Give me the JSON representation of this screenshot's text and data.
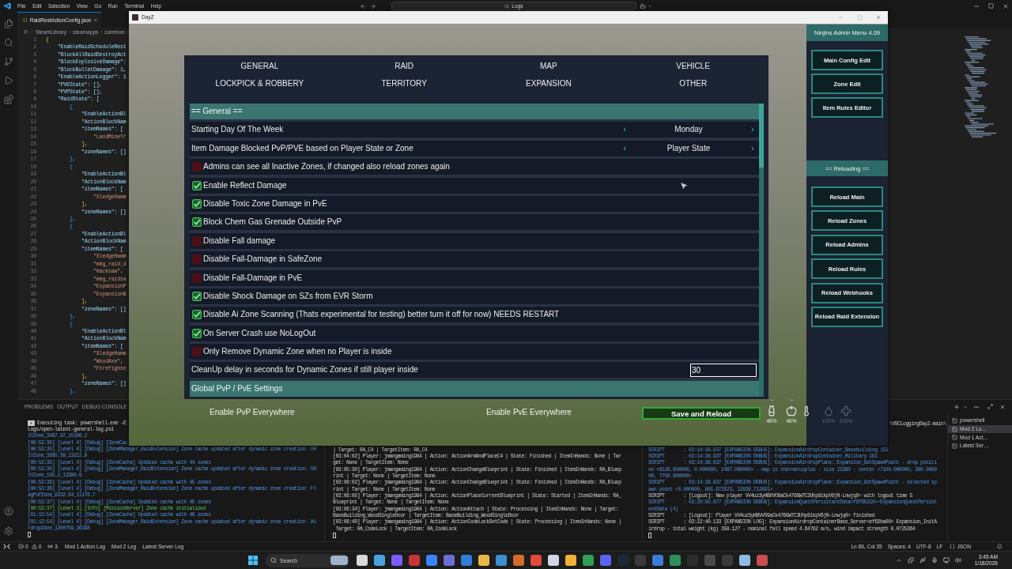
{
  "vscode": {
    "menu": [
      "File",
      "Edit",
      "Selection",
      "View",
      "Go",
      "Run",
      "Terminal",
      "Help"
    ],
    "search": {
      "value": "Logs"
    },
    "tab": {
      "label": "RaidRestrictionConfig.json"
    },
    "breadcrumb": [
      "F:",
      "SteamLibrary",
      "steamapps",
      "common"
    ],
    "code_lines": [
      {
        "number": "1",
        "text": "{",
        "kind": "bracket"
      },
      {
        "number": "2",
        "text": "    \"EnableRaidScheduleRest",
        "kind": "key"
      },
      {
        "number": "3",
        "text": "    \"BlockAllRaidDestroyAct",
        "kind": "key"
      },
      {
        "number": "4",
        "text": "    \"BlockExplosiveDamage\":",
        "kind": "key"
      },
      {
        "number": "5",
        "text": "    \"BlockBulletDamage\": 1,",
        "kind": "key"
      },
      {
        "number": "6",
        "text": "    \"EnableActionLogger\": 1",
        "kind": "key"
      },
      {
        "number": "7",
        "text": "    \"PVEState\": [],",
        "kind": "key"
      },
      {
        "number": "8",
        "text": "    \"PVPState\": [],",
        "kind": "key"
      },
      {
        "number": "9",
        "text": "    \"RaidState\": [",
        "kind": "key"
      },
      {
        "number": "10",
        "text": "        {",
        "kind": "brace"
      },
      {
        "number": "11",
        "text": "            \"EnableActionBl",
        "kind": "key"
      },
      {
        "number": "12",
        "text": "            \"ActionBlockNam",
        "kind": "key"
      },
      {
        "number": "13",
        "text": "            \"itemNames\": [",
        "kind": "key"
      },
      {
        "number": "14",
        "text": "                \"LandMineTr",
        "kind": "string"
      },
      {
        "number": "15",
        "text": "            ],",
        "kind": "bracket"
      },
      {
        "number": "16",
        "text": "            \"zoneNames\": []",
        "kind": "key"
      },
      {
        "number": "17",
        "text": "        },",
        "kind": "brace"
      },
      {
        "number": "18",
        "text": "        {",
        "kind": "brace"
      },
      {
        "number": "19",
        "text": "            \"EnableActionBl",
        "kind": "key"
      },
      {
        "number": "20",
        "text": "            \"ActionBlockNam",
        "kind": "key"
      },
      {
        "number": "21",
        "text": "            \"itemNames\": [",
        "kind": "key"
      },
      {
        "number": "22",
        "text": "                \"SledgeHamm",
        "kind": "string"
      },
      {
        "number": "23",
        "text": "            ],",
        "kind": "bracket"
      },
      {
        "number": "24",
        "text": "            \"zoneNames\": []",
        "kind": "key"
      },
      {
        "number": "25",
        "text": "        },",
        "kind": "brace"
      },
      {
        "number": "26",
        "text": "        {",
        "kind": "brace"
      },
      {
        "number": "27",
        "text": "            \"EnableActionBl",
        "kind": "key"
      },
      {
        "number": "28",
        "text": "            \"ActionBlockNam",
        "kind": "key"
      },
      {
        "number": "29",
        "text": "            \"itemNames\": [",
        "kind": "key"
      },
      {
        "number": "30",
        "text": "                \"SledgeHamm",
        "kind": "string"
      },
      {
        "number": "31",
        "text": "                \"mmg_raid_d",
        "kind": "string"
      },
      {
        "number": "32",
        "text": "                \"Hacksaw\",",
        "kind": "string"
      },
      {
        "number": "33",
        "text": "                \"mmg_raidsa",
        "kind": "string"
      },
      {
        "number": "34",
        "text": "                \"ExpansionP",
        "kind": "string"
      },
      {
        "number": "35",
        "text": "                \"ExpansionB",
        "kind": "string"
      },
      {
        "number": "36",
        "text": "            ],",
        "kind": "bracket"
      },
      {
        "number": "37",
        "text": "            \"zoneNames\": []",
        "kind": "key"
      },
      {
        "number": "38",
        "text": "        },",
        "kind": "brace"
      },
      {
        "number": "39",
        "text": "        {",
        "kind": "brace"
      },
      {
        "number": "40",
        "text": "            \"EnableActionBl",
        "kind": "key"
      },
      {
        "number": "41",
        "text": "            \"ActionBlockNam",
        "kind": "key"
      },
      {
        "number": "42",
        "text": "            \"itemNames\": [",
        "kind": "key"
      },
      {
        "number": "43",
        "text": "                \"SledgeHamm",
        "kind": "string"
      },
      {
        "number": "44",
        "text": "                \"WoodAxe\",",
        "kind": "string"
      },
      {
        "number": "45",
        "text": "                \"Firefighte",
        "kind": "string"
      },
      {
        "number": "46",
        "text": "            ],",
        "kind": "bracket"
      },
      {
        "number": "47",
        "text": "            \"zoneNames\": []",
        "kind": "key"
      },
      {
        "number": "48",
        "text": "        },",
        "kind": "brace"
      }
    ],
    "panel_tabs": [
      "PROBLEMS",
      "OUTPUT",
      "DEBUG CONSOLE"
    ],
    "terminal_left": [
      {
        "kind": "task",
        "text": "Executing task: powershell.exe -E"
      },
      {
        "kind": "plain",
        "text": "Logs/open-latest-general-log.ps1"
      },
      {
        "kind": "debug",
        "text": "1YZone_3487.97_15106.2"
      },
      {
        "kind": "debug",
        "text": "[00:53:35] [Level 4] [Debug] [ZoneCac"
      },
      {
        "kind": "debug",
        "text": "[00:53:35] [Level 4] [Debug] [ZoneManager_RaidExtension] Zone cache updated after dynamic zone creation: UH"
      },
      {
        "kind": "debug",
        "text": "1YZone_3885.59_13212.9"
      },
      {
        "kind": "debug",
        "text": "[00:53:35] [Level 4] [Debug] [ZoneCache] Updated cache with 44 zones"
      },
      {
        "kind": "debug",
        "text": "[00:53:35] [Level 4] [Debug] [ZoneManager_RaidExtension] Zone cache updated after dynamic zone creation: UH"
      },
      {
        "kind": "debug",
        "text": "1YZone_155.2_13380.6"
      },
      {
        "kind": "debug",
        "text": "[00:53:36] [Level 4] [Debug] [ZoneCache] Updated cache with 45 zones"
      },
      {
        "kind": "debug",
        "text": "[00:53:36] [Level 4] [Debug] [ZoneManager_RaidExtension] Zone cache updated after dynamic zone creation: Fl"
      },
      {
        "kind": "debug",
        "text": "agPvPZone_8332.84_11176.7"
      },
      {
        "kind": "debug",
        "text": "[00:53:37] [Level 4] [Debug] [ZoneCache] Updated cache with 45 zones"
      },
      {
        "kind": "info",
        "text": "[00:53:37] [Level 3] [Info] [MissionServer] Zone cache initialized"
      },
      {
        "kind": "debug",
        "text": "[01:13:54] [Level 4] [Debug] [ZoneCache] Updated cache with 46 zones"
      },
      {
        "kind": "debug",
        "text": "[01:13:54] [Level 4] [Debug] [ZoneManager_RaidExtension] Zone cache updated after dynamic zone creation: Ai"
      },
      {
        "kind": "debug",
        "text": "rdropZone_1200759_36338"
      }
    ],
    "terminal_middle": [
      {
        "kind": "plain",
        "text": "| Target: RA_C4 | TargetItem: RA_C4"
      },
      {
        "kind": "plain",
        "text": "[03:04:02] Player: jmangaming1984 | Action: ActionArmAndPlaceC4 | State: Finished | ItemInHands: None | Tar"
      },
      {
        "kind": "plain",
        "text": "get: None | TargetItem: None"
      },
      {
        "kind": "plain",
        "text": "[03:05:30] Player: jmangaming1984 | Action: ActionChangeBlueprint | State: Finished | ItemInHands: RA_Bluep"
      },
      {
        "kind": "plain",
        "text": "rint | Target: None | TargetItem: None"
      },
      {
        "kind": "plain",
        "text": "[03:06:02] Player: jmangaming1984 | Action: ActionChangeBlueprint | State: Finished | ItemInHands: RA_Bluep"
      },
      {
        "kind": "plain",
        "text": "rint | Target: None | TargetItem: None"
      },
      {
        "kind": "plain",
        "text": "[03:06:05] Player: jmangaming1984 | Action: ActionPlaceCurrentBlueprint | State: Started | ItemInHands: RA_"
      },
      {
        "kind": "plain",
        "text": "Blueprint | Target: None | TargetItem: None"
      },
      {
        "kind": "plain",
        "text": "[03:06:34] Player: jmangaming1984 | Action: ActionAttach | State: Processing | ItemInHands: None | Target:"
      },
      {
        "kind": "plain",
        "text": "BaseBuilding_WoodSingleDoor | TargetItem: BaseBuilding_WoodSingleDoor"
      },
      {
        "kind": "plain",
        "text": "[03:06:40] Player: jmangaming1984 | Action: ActionCodeLockSetCode | State: Processing | ItemInHands: None |"
      },
      {
        "kind": "plain",
        "text": " Target: RA_CodeLock | TargetItem: RA_CodeLock"
      }
    ],
    "terminal_path": "\\VSCLoggingDayZ-main\\",
    "terminal_right": [
      {
        "kind": "debug",
        "text": "SCRIPT       : 03:14:38.937 [EXPANSION DEBUG]: ExpansionAirdropContainer_Basebuilding 151"
      },
      {
        "kind": "debug",
        "text": "SCRIPT       : 03:14:38.937 [EXPANSION DEBUG]: ExpansionAirdropContainer_Military 161"
      },
      {
        "kind": "debug",
        "text": "SCRIPT       : 03:14:38.937 [EXPANSION DEBUG]: ExpansionAirdropPlane::Expansion_GetSpawnPoint - drop positi"
      },
      {
        "kind": "debug",
        "text": "on <6128.000000, 0.000000, 2497.000000> - map is chernarusplus - size 15360 - center <7100.000000, 300.0000"
      },
      {
        "kind": "debug",
        "text": "00, 7750.000000>"
      },
      {
        "kind": "debug",
        "text": "SCRIPT       : 03:14:38.937 [EXPANSION DEBUG]: ExpansionAirdropPlane::Expansion_GetSpawnPoint - selected sp"
      },
      {
        "kind": "debug",
        "text": "awn point <0.000000, 885.673523, 12838.712891>"
      },
      {
        "kind": "plain",
        "text": "SCRIPT       : [Logout]: New player VV4uz3yHBVVO9aCk476GW7C3Uhp8ikpV6jN-Lnwjq0= with logout time 5"
      },
      {
        "kind": "debug",
        "text": "SCRIPT       : 03:20:50.077 [EXPANSION DEBUG]: ExpansionQuestPersistentData<f9f95210>~ExpansionQuestPersist"
      },
      {
        "kind": "debug",
        "text": "entData (4)"
      },
      {
        "kind": "plain",
        "text": "SCRIPT       : [Logout]: Player VV4uz3yHBVVO9aCk476GW7C3Uhp8ikpV6jN-Lnwjq0= finished"
      },
      {
        "kind": "plain",
        "text": "SCRIPT       : 03:22:40.133 [EXPANSION LOG]: ExpansionAirdropContainerBase_Server<ef62ba00> Expansion_InitA"
      },
      {
        "kind": "plain",
        "text": "irdrop - total weight (kg) 359.127 - nominal fall speed 4.64782 m/s, wind impact strength 0.0725364"
      }
    ],
    "terminal_list": [
      {
        "label": "powershell",
        "selected": false
      },
      {
        "label": "Mod 2 Lo…",
        "selected": true
      },
      {
        "label": "Mod 1 Act…",
        "selected": false
      },
      {
        "label": "Latest Ser…",
        "selected": false
      }
    ],
    "status_bar": {
      "errors": "0",
      "warnings": "0",
      "ports": "3",
      "items": [
        "Mod 1 Action Log",
        "Mod 2 Log",
        "Latest Server Log"
      ],
      "right": [
        "Ln 86, Col 35",
        "Spaces: 4",
        "UTF-8",
        "LF"
      ],
      "language": "JSON"
    }
  },
  "taskbar": {
    "search": {
      "placeholder": "Search"
    },
    "time": "3:45 AM",
    "date": "1/18/2026"
  },
  "dayz": {
    "window_title": "DayZ",
    "tabs": [
      {
        "label": "GENERAL"
      },
      {
        "label": "RAID"
      },
      {
        "label": "MAP"
      },
      {
        "label": "VEHICLE"
      },
      {
        "label": "LOCKPICK & ROBBERY"
      },
      {
        "label": "TERRITORY"
      },
      {
        "label": "EXPANSION"
      },
      {
        "label": "OTHER"
      }
    ],
    "settings": [
      {
        "kind": "section",
        "label": "== General =="
      },
      {
        "kind": "selector",
        "label": "Starting Day Of The Week",
        "value": "Monday"
      },
      {
        "kind": "selector",
        "label": "Item Damage Blocked PvP/PVE based on Player State or Zone",
        "value": "Player State"
      },
      {
        "kind": "checkbox",
        "label": "Admins can see all Inactive Zones, if changed also reload zones again",
        "checked": false
      },
      {
        "kind": "checkbox",
        "label": "Enable Reflect Damage",
        "checked": true
      },
      {
        "kind": "checkbox",
        "label": "Disable Toxic Zone Damage in PvE",
        "checked": true
      },
      {
        "kind": "checkbox",
        "label": "Block Chem Gas Grenade Outside PvP",
        "checked": true
      },
      {
        "kind": "checkbox",
        "label": "Disable Fall damage",
        "checked": false
      },
      {
        "kind": "checkbox",
        "label": "Disable Fall-Damage in SafeZone",
        "checked": false
      },
      {
        "kind": "checkbox",
        "label": "Disable Fall-Damage in PvE",
        "checked": false
      },
      {
        "kind": "checkbox",
        "label": "Disable Shock Damage on SZs from EVR Storm",
        "checked": true
      },
      {
        "kind": "checkbox",
        "label": "Disable Ai Zone Scanning (Thats experimental for testing) better turn it off for now) NEEDS RESTART",
        "checked": true
      },
      {
        "kind": "checkbox",
        "label": "On Server Crash use NoLogOut",
        "checked": true
      },
      {
        "kind": "checkbox",
        "label": "Only Remove Dynamic Zone when no Player is inside",
        "checked": false
      },
      {
        "kind": "number",
        "label": "CleanUp delay in seconds for Dynamic Zones if still player inside",
        "value": "30"
      },
      {
        "kind": "section",
        "label": "Global PvP / PvE Settings"
      }
    ],
    "below_panel": [
      "Enable PvP Everywhere",
      "Enable PvE Everywhere"
    ],
    "save_button": "Save and Reload",
    "hud": [
      {
        "kind": "water",
        "reading": "46%",
        "dimmed": false
      },
      {
        "kind": "food",
        "reading": "46%",
        "dimmed": false
      },
      {
        "kind": "temperature",
        "dimmed": false
      },
      {
        "kind": "blood",
        "reading": "100%",
        "dimmed": true
      },
      {
        "kind": "health",
        "reading": "100%",
        "dimmed": true
      }
    ],
    "admin_menu": {
      "title": "Ninjins Admin Menu 4.09",
      "buttons": [
        "Main Config Edit",
        "Zone Edit",
        "Item Rules Editor"
      ],
      "section": "== Reloading ==",
      "reload_buttons": [
        "Reload Main",
        "Reload Zones",
        "Reload Admins",
        "Reload Rules",
        "Reload Webhooks",
        "Reload Raid Extension"
      ]
    }
  }
}
